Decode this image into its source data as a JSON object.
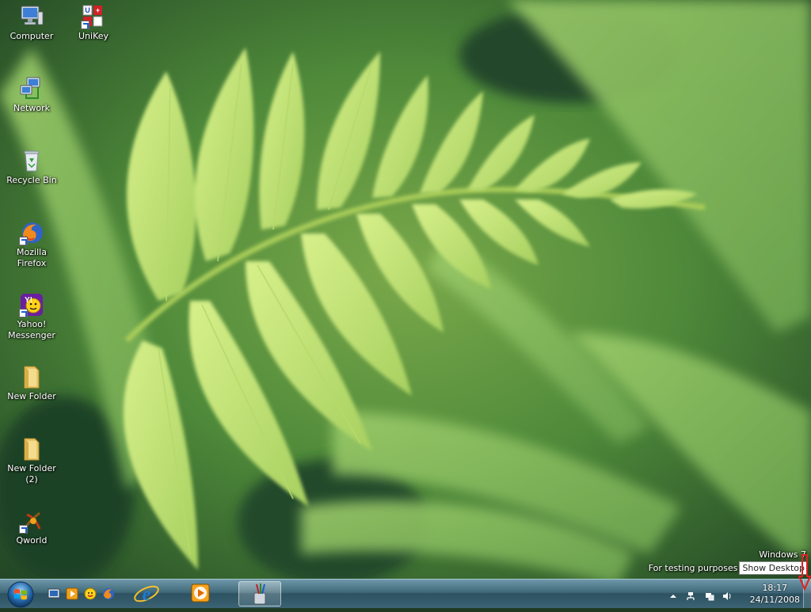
{
  "desktop": {
    "icons": [
      {
        "label": "Computer",
        "icon": "computer-icon"
      },
      {
        "label": "UniKey",
        "icon": "unikey-icon"
      },
      {
        "label": "Network",
        "icon": "network-icon"
      },
      {
        "label": "Recycle Bin",
        "icon": "recycle-bin-icon"
      },
      {
        "label": "Mozilla\nFirefox",
        "icon": "firefox-icon"
      },
      {
        "label": "Yahoo!\nMessenger",
        "icon": "yahoo-messenger-icon"
      },
      {
        "label": "New Folder",
        "icon": "folder-icon"
      },
      {
        "label": "New Folder\n(2)",
        "icon": "folder-icon"
      },
      {
        "label": "Qworld",
        "icon": "qworld-icon"
      }
    ]
  },
  "watermark": {
    "line1": "Windows 7",
    "line2": "For testing purposes",
    "tooltip": "Show Desktop"
  },
  "taskbar": {
    "quick_launch": [
      "show-desktop-icon",
      "media-player-icon",
      "messenger-icon",
      "firefox-icon"
    ],
    "pinned": [
      "internet-explorer-icon",
      "media-player-icon"
    ],
    "running": [
      "paint-icon"
    ],
    "tray_icons": [
      "show-hidden-icons-chevron",
      "network-icon",
      "action-center-icon",
      "volume-icon"
    ],
    "clock": {
      "time": "18:17",
      "date": "24/11/2008"
    }
  },
  "colors": {
    "taskbar": "#3f6878",
    "annotation_arrow": "#e02020"
  }
}
